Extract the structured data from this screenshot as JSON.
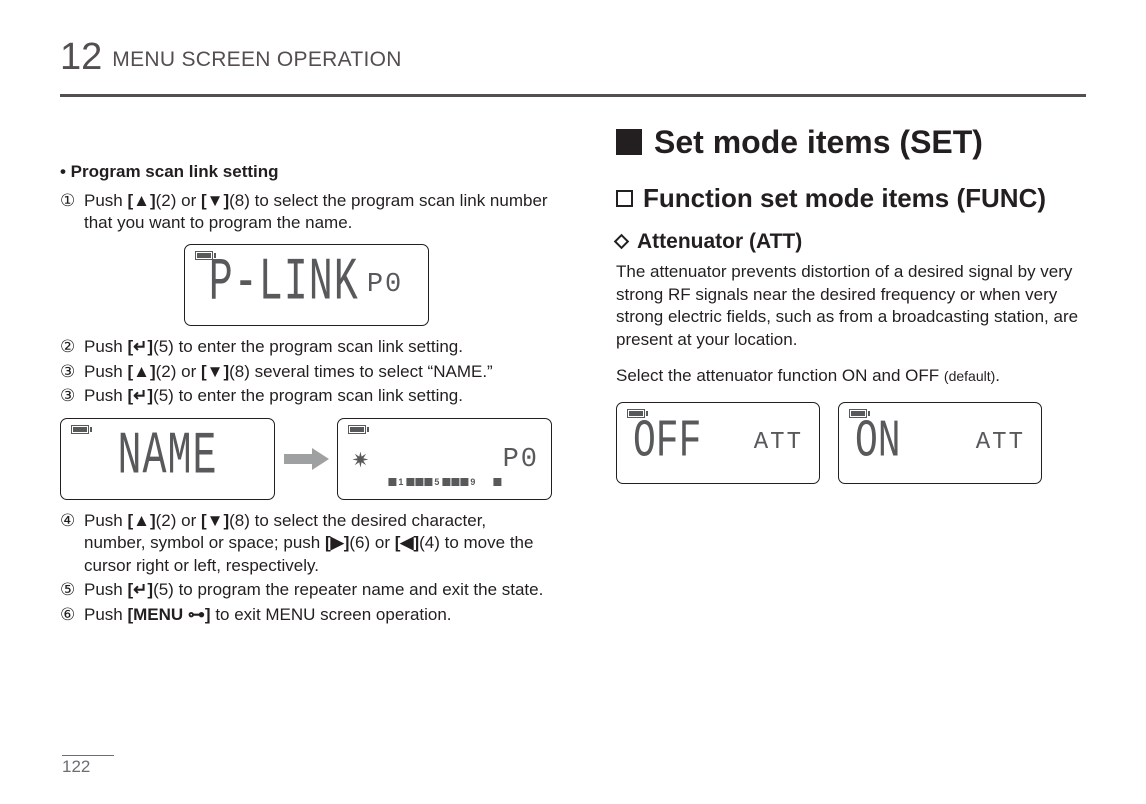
{
  "header": {
    "chapter_num": "12",
    "chapter_title": "MENU SCREEN OPERATION"
  },
  "left": {
    "section_title": "• Program scan link setting",
    "steps": {
      "s1": {
        "num": "①",
        "text_a": "Push ",
        "key_a": "[▲]",
        "key_a_suffix": "(2) or ",
        "key_b": "[▼]",
        "key_b_suffix": "(8) to select the program scan link number that you want to program the name."
      },
      "lcd1_big": "P-LINK",
      "lcd1_sub": "P0",
      "s2": {
        "num": "②",
        "text_a": "Push ",
        "key": "[↵]",
        "suffix": "(5) to enter the program scan link setting."
      },
      "s3": {
        "num": "③",
        "text_a": "Push ",
        "key_a": "[▲]",
        "key_a_suffix": "(2) or ",
        "key_b": "[▼]",
        "key_b_suffix": "(8) several times to select “NAME.”"
      },
      "s3b": {
        "num": "③",
        "text_a": "Push ",
        "key": "[↵]",
        "suffix": "(5) to enter the program scan link setting."
      },
      "lcd2_big": "NAME",
      "lcd3_sub": "P0",
      "ruler_num1": "1",
      "ruler_num5": "5",
      "ruler_num9": "9",
      "s4": {
        "num": "④",
        "text_a": "Push ",
        "key_a": "[▲]",
        "key_a_suffix": "(2) or ",
        "key_b": "[▼]",
        "key_b_suffix": "(8) to select the desired character, number, symbol or space; push ",
        "key_c": "[▶]",
        "key_c_suffix": "(6) or ",
        "key_d": "[◀]",
        "key_d_suffix": "(4) to move the cursor right or left, respectively."
      },
      "s5": {
        "num": "⑤",
        "text_a": "Push ",
        "key": "[↵]",
        "suffix": "(5) to program the repeater name and exit the state."
      },
      "s6": {
        "num": "⑥",
        "text_a": "Push ",
        "key": "[MENU ⊶]",
        "suffix": " to exit MENU screen operation."
      }
    }
  },
  "right": {
    "h1": "Set mode items (SET)",
    "h2": "Function set mode items (FUNC)",
    "h3": "Attenuator (ATT)",
    "para1": "The attenuator prevents distortion of a desired signal by very strong RF signals near the desired frequency or when very strong electric fields, such as from a broadcasting station, are present at your location.",
    "para2_a": "Select the attenuator function ON and OFF ",
    "para2_b": "(default)",
    "para2_c": ".",
    "lcd_off_main": "OFF",
    "lcd_off_sub": "ATT",
    "lcd_on_main": "ON",
    "lcd_on_sub": "ATT"
  },
  "footer": {
    "page": "122"
  }
}
